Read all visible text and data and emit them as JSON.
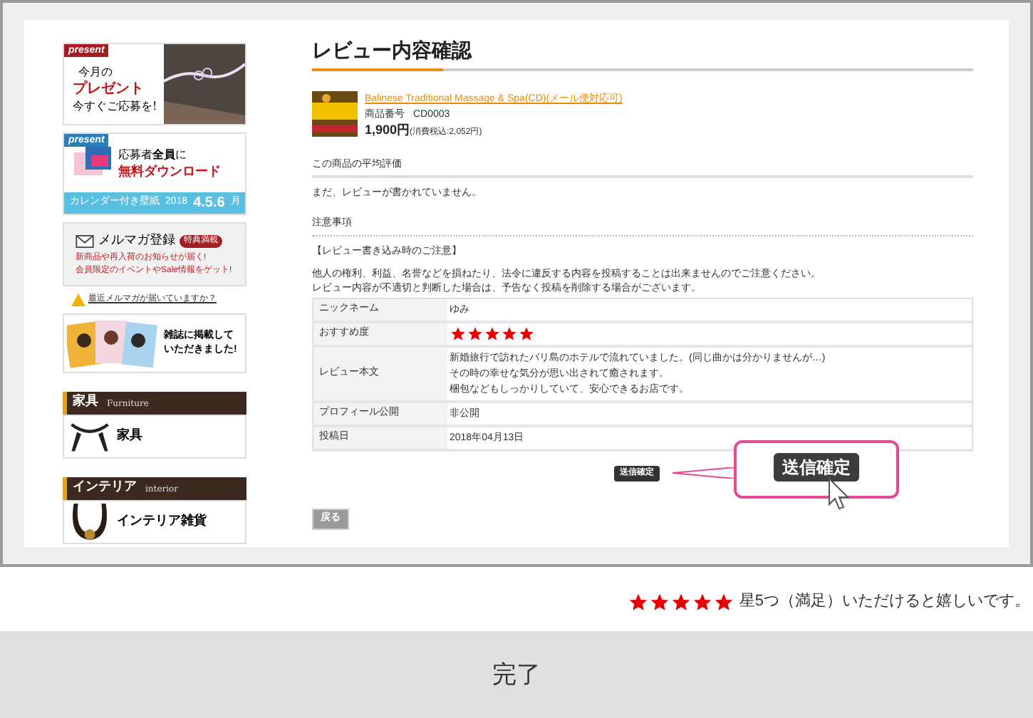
{
  "sidebar": {
    "present_banner": {
      "tag": "present",
      "lines": [
        "今月の",
        "プレゼント",
        "今すぐご応募を!"
      ]
    },
    "download_banner": {
      "tag": "present",
      "line1": "応募者**全員**に",
      "line2": "無料ダウンロード",
      "footer": "カレンダー付き壁紙",
      "date": "2018",
      "date_big": "4.5.6",
      "date_unit": "月"
    },
    "mail_banner": {
      "title": "メルマガ登録",
      "badge": "特典満載",
      "line1": "新商品や再入荷のお知らせが届く!",
      "line2": "会員限定のイベントやSale情報をゲット!"
    },
    "mail_link": "最近メルマガが届いていますか？",
    "magazine_banner": {
      "text": "雑誌に掲載していただきました!"
    },
    "categories": [
      {
        "title": "家具",
        "subtitle": "Furniture",
        "items": [
          {
            "kind": "chair",
            "label": "家具"
          }
        ]
      },
      {
        "title": "インテリア",
        "subtitle": "interior",
        "items": [
          {
            "kind": "horseshoe",
            "label": "インテリア雑貨"
          }
        ]
      }
    ]
  },
  "main": {
    "title": "レビュー内容確認",
    "product": {
      "name": "Balinese Traditional Massage & Spa(CD)(メール便対応可)",
      "code_label": "商品番号",
      "code": "CD0003",
      "price": "1,900円",
      "tax": "(消費税込:2,052円)"
    },
    "average": {
      "heading": "この商品の平均評価",
      "text": "まだ、レビューが書かれていません。"
    },
    "notes": {
      "heading": "注意事項",
      "subheading": "【レビュー書き込み時のご注意】",
      "lines": [
        "他人の権利、利益、名誉などを損ねたり、法令に違反する内容を投稿することは出来ませんのでご注意ください。",
        "レビュー内容が不適切と判断した場合は、予告なく投稿を削除する場合がございます。"
      ]
    },
    "table": [
      {
        "kind": "text",
        "label": "ニックネーム",
        "lines": [
          "ゆみ"
        ]
      },
      {
        "kind": "stars",
        "label": "おすすめ度",
        "stars": 5
      },
      {
        "kind": "text",
        "label": "レビュー本文",
        "lines": [
          "新婚旅行で訪れたバリ島のホテルで流れていました。(同じ曲かは分かりませんが…)",
          "その時の幸せな気分が思い出されて癒されます。",
          "梱包などもしっかりしていて、安心できるお店です。"
        ]
      },
      {
        "kind": "text",
        "label": "プロフィール公開",
        "lines": [
          "非公開"
        ]
      },
      {
        "kind": "text",
        "label": "投稿日",
        "lines": [
          "2018年04月13日"
        ]
      }
    ],
    "submit_button": "送信確定",
    "callout_button": "送信確定",
    "back_button": "戻る"
  },
  "caption": {
    "stars": 5,
    "text": "星5つ（満足）いただけると嬉しいです。"
  },
  "footer": {
    "label": "完了"
  }
}
